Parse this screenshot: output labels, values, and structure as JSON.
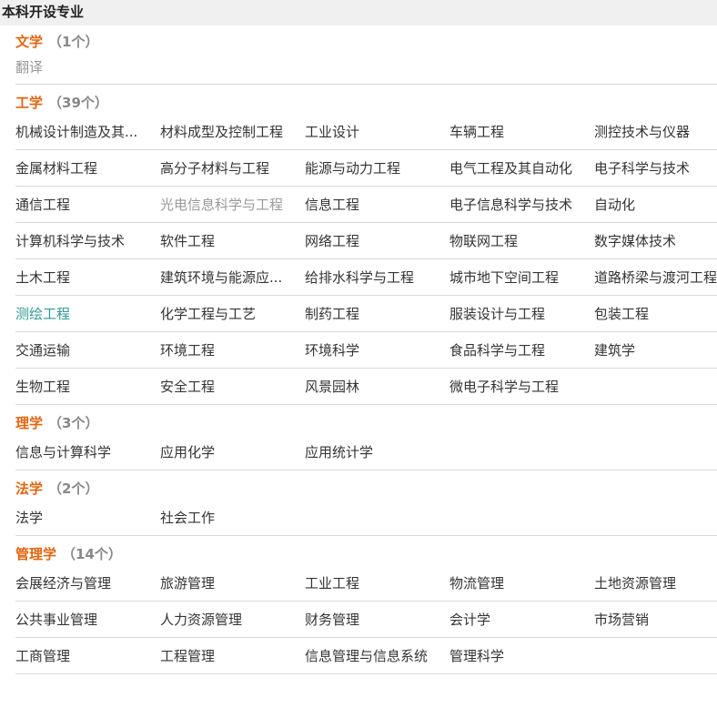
{
  "header": {
    "title": "本科开设专业"
  },
  "colors": {
    "category": "#e2640d",
    "count": "#888888",
    "muted": "#999999",
    "highlight": "#2f9b93",
    "divider": "#d8d8d8"
  },
  "categories": [
    {
      "name": "文学",
      "count": "（1个）",
      "rows": [
        [
          {
            "label": "翻译",
            "style": "muted"
          }
        ]
      ]
    },
    {
      "name": "工学",
      "count": "（39个）",
      "rows": [
        [
          {
            "label": "机械设计制造及其..."
          },
          {
            "label": "材料成型及控制工程"
          },
          {
            "label": "工业设计"
          },
          {
            "label": "车辆工程"
          },
          {
            "label": "测控技术与仪器"
          }
        ],
        [
          {
            "label": "金属材料工程"
          },
          {
            "label": "高分子材料与工程"
          },
          {
            "label": "能源与动力工程"
          },
          {
            "label": "电气工程及其自动化"
          },
          {
            "label": "电子科学与技术"
          }
        ],
        [
          {
            "label": "通信工程"
          },
          {
            "label": "光电信息科学与工程",
            "style": "muted"
          },
          {
            "label": "信息工程"
          },
          {
            "label": "电子信息科学与技术"
          },
          {
            "label": "自动化"
          }
        ],
        [
          {
            "label": "计算机科学与技术"
          },
          {
            "label": "软件工程"
          },
          {
            "label": "网络工程"
          },
          {
            "label": "物联网工程"
          },
          {
            "label": "数字媒体技术"
          }
        ],
        [
          {
            "label": "土木工程"
          },
          {
            "label": "建筑环境与能源应..."
          },
          {
            "label": "给排水科学与工程"
          },
          {
            "label": "城市地下空间工程"
          },
          {
            "label": "道路桥梁与渡河工程"
          }
        ],
        [
          {
            "label": "测绘工程",
            "style": "teal"
          },
          {
            "label": "化学工程与工艺"
          },
          {
            "label": "制药工程"
          },
          {
            "label": "服装设计与工程"
          },
          {
            "label": "包装工程"
          }
        ],
        [
          {
            "label": "交通运输"
          },
          {
            "label": "环境工程"
          },
          {
            "label": "环境科学"
          },
          {
            "label": "食品科学与工程"
          },
          {
            "label": "建筑学"
          }
        ],
        [
          {
            "label": "生物工程"
          },
          {
            "label": "安全工程"
          },
          {
            "label": "风景园林"
          },
          {
            "label": "微电子科学与工程"
          }
        ]
      ]
    },
    {
      "name": "理学",
      "count": "（3个）",
      "rows": [
        [
          {
            "label": "信息与计算科学"
          },
          {
            "label": "应用化学"
          },
          {
            "label": "应用统计学"
          }
        ]
      ]
    },
    {
      "name": "法学",
      "count": "（2个）",
      "rows": [
        [
          {
            "label": "法学"
          },
          {
            "label": "社会工作"
          }
        ]
      ]
    },
    {
      "name": "管理学",
      "count": "（14个）",
      "rows": [
        [
          {
            "label": "会展经济与管理"
          },
          {
            "label": "旅游管理"
          },
          {
            "label": "工业工程"
          },
          {
            "label": "物流管理"
          },
          {
            "label": "土地资源管理"
          }
        ],
        [
          {
            "label": "公共事业管理"
          },
          {
            "label": "人力资源管理"
          },
          {
            "label": "财务管理"
          },
          {
            "label": "会计学"
          },
          {
            "label": "市场营销"
          }
        ],
        [
          {
            "label": "工商管理"
          },
          {
            "label": "工程管理"
          },
          {
            "label": "信息管理与信息系统"
          },
          {
            "label": "管理科学"
          }
        ]
      ]
    }
  ]
}
